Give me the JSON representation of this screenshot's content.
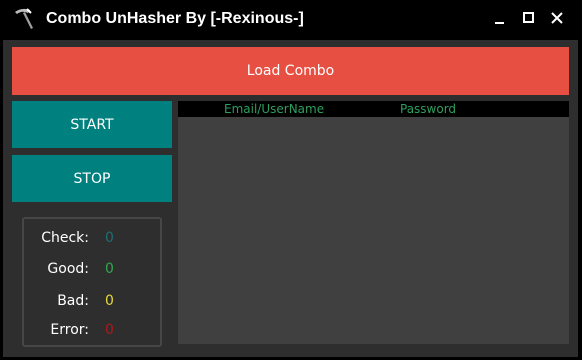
{
  "window": {
    "title": "Combo UnHasher By [-Rexinous-]",
    "icon": "pickaxe-icon",
    "controls": [
      "minimize-icon",
      "maximize-icon",
      "close-icon"
    ]
  },
  "actions": {
    "load_label": "Load Combo",
    "start_label": "START",
    "stop_label": "STOP"
  },
  "stats": {
    "check": {
      "label": "Check:",
      "value": "0",
      "color": "#1e6f73"
    },
    "good": {
      "label": "Good:",
      "value": "0",
      "color": "#2fa84f"
    },
    "bad": {
      "label": "Bad:",
      "value": "0",
      "color": "#e6d93a"
    },
    "error": {
      "label": "Error:",
      "value": "0",
      "color": "#b01818"
    }
  },
  "results": {
    "columns": [
      "Email/UserName",
      "Password"
    ],
    "rows": []
  },
  "colors": {
    "load_button": "#e74f42",
    "side_buttons": "#00807f",
    "column_header_text": "#2e9e5e"
  }
}
